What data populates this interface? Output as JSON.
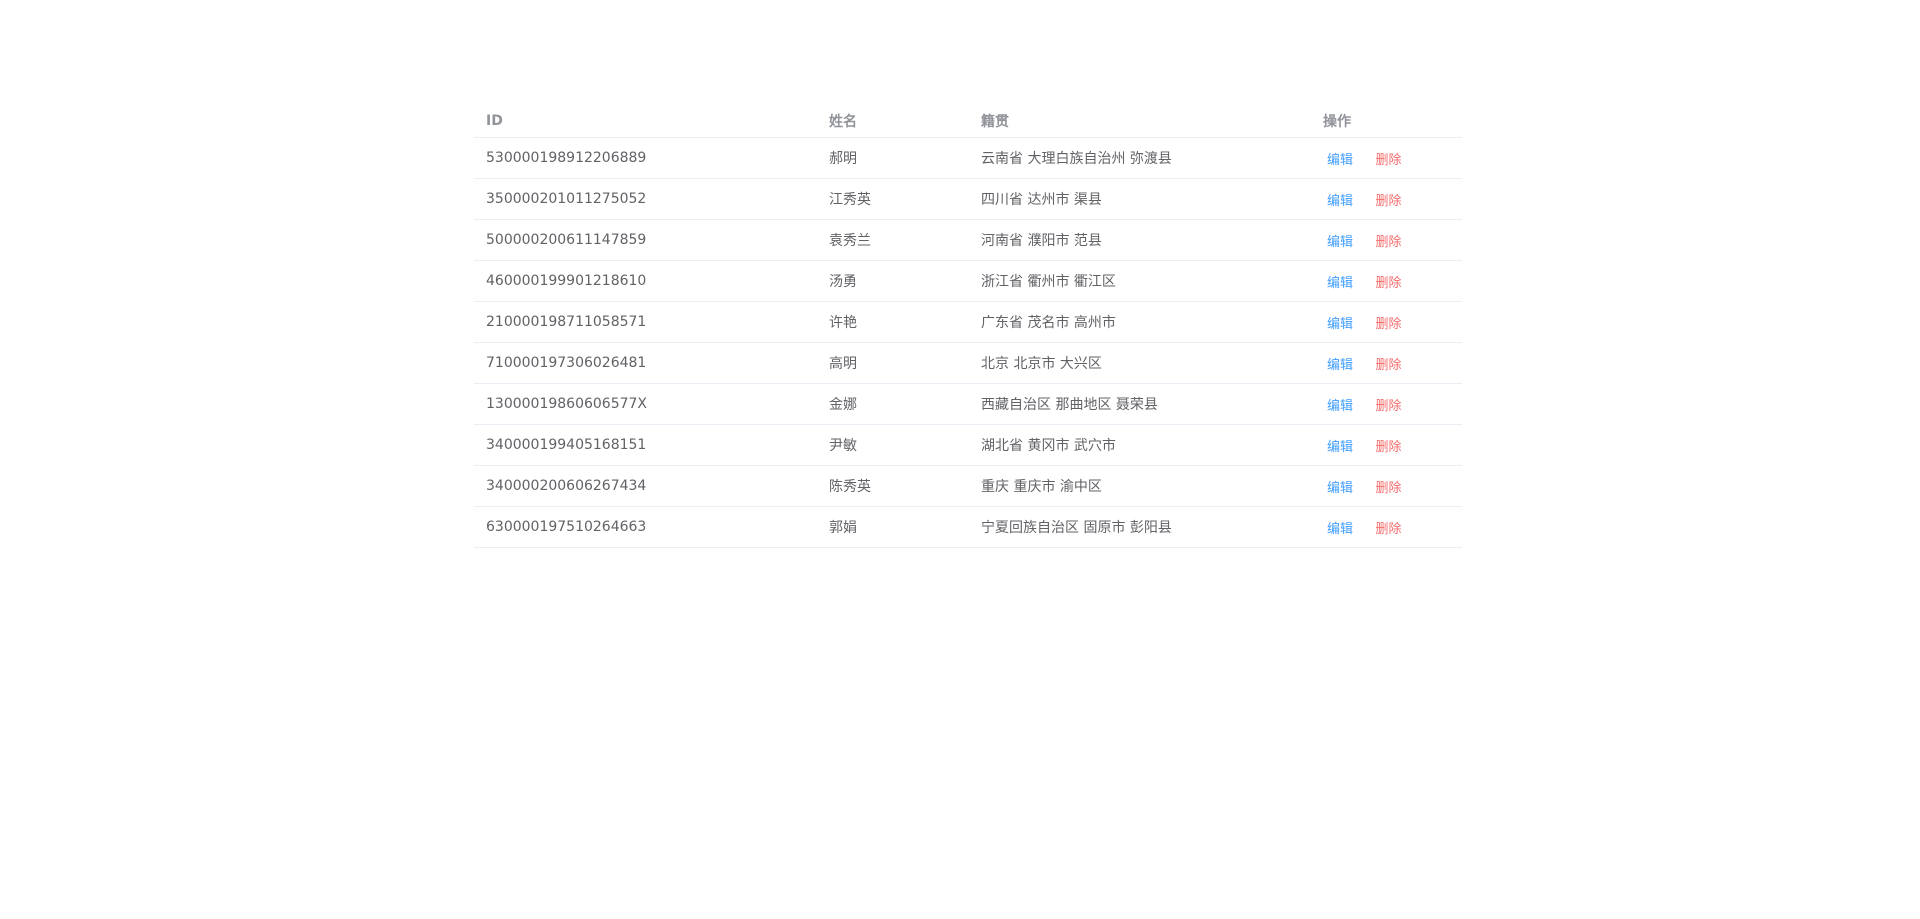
{
  "table": {
    "headers": {
      "id": "ID",
      "name": "姓名",
      "origin": "籍贯",
      "ops": "操作"
    },
    "actions": {
      "edit": "编辑",
      "delete": "删除"
    },
    "rows": [
      {
        "id": "530000198912206889",
        "name": "郝明",
        "origin": "云南省 大理白族自治州 弥渡县"
      },
      {
        "id": "350000201011275052",
        "name": "江秀英",
        "origin": "四川省 达州市 渠县"
      },
      {
        "id": "500000200611147859",
        "name": "袁秀兰",
        "origin": "河南省 濮阳市 范县"
      },
      {
        "id": "460000199901218610",
        "name": "汤勇",
        "origin": "浙江省 衢州市 衢江区"
      },
      {
        "id": "210000198711058571",
        "name": "许艳",
        "origin": "广东省 茂名市 高州市"
      },
      {
        "id": "710000197306026481",
        "name": "高明",
        "origin": "北京 北京市 大兴区"
      },
      {
        "id": "13000019860606577X",
        "name": "金娜",
        "origin": "西藏自治区 那曲地区 聂荣县"
      },
      {
        "id": "340000199405168151",
        "name": "尹敏",
        "origin": "湖北省 黄冈市 武穴市"
      },
      {
        "id": "340000200606267434",
        "name": "陈秀英",
        "origin": "重庆 重庆市 渝中区"
      },
      {
        "id": "630000197510264663",
        "name": "郭娟",
        "origin": "宁夏回族自治区 固原市 彭阳县"
      }
    ]
  },
  "colors": {
    "edit": "#409eff",
    "delete": "#f56c6c",
    "text": "#606266",
    "header": "#909399",
    "border": "#ebeef5"
  }
}
